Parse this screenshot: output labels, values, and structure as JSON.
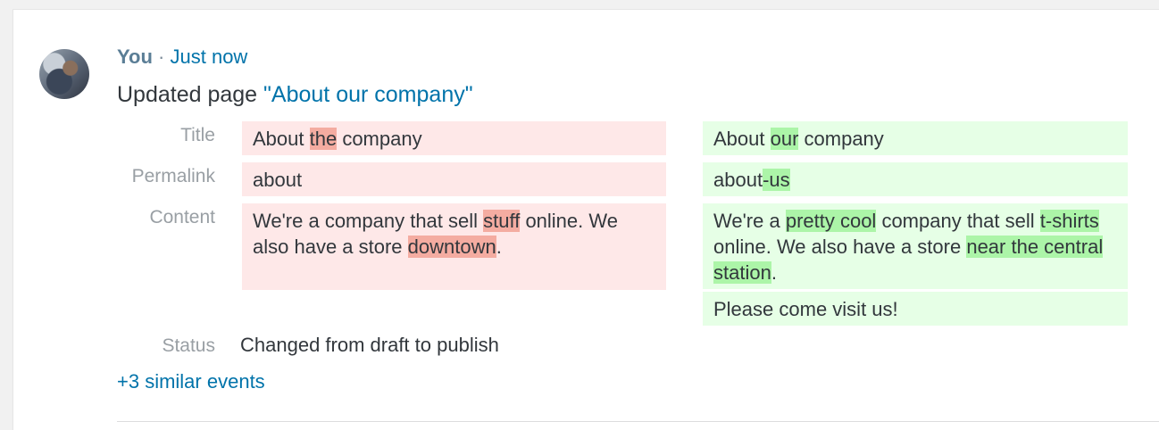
{
  "event": {
    "actor": "You",
    "separator": "·",
    "time": "Just now",
    "action": "Updated page",
    "object_link": "\"About our company\""
  },
  "diff": {
    "title_label": "Title",
    "permalink_label": "Permalink",
    "content_label": "Content",
    "status_label": "Status",
    "old": {
      "title": [
        "About ",
        "the",
        " company"
      ],
      "permalink": "about",
      "content": [
        "We're a company that sell ",
        "stuff",
        " online. We also have a store ",
        "downtown",
        "."
      ]
    },
    "new": {
      "title": [
        "About ",
        "our",
        " company"
      ],
      "permalink": [
        "about",
        "-us"
      ],
      "content": [
        "We're a ",
        "pretty cool",
        " company that sell ",
        "t-shirts",
        " online. We also have a store ",
        "near the central station",
        "."
      ],
      "content_extra": "Please come visit us!"
    },
    "status_value": "Changed from draft to publish"
  },
  "similar_events_link": "+3 similar events",
  "colors": {
    "old_bg": "#fee8e8",
    "new_bg": "#e6ffe6",
    "deleted_highlight": "#f4aca1",
    "inserted_highlight": "#acf5a8",
    "link": "#0073aa"
  }
}
